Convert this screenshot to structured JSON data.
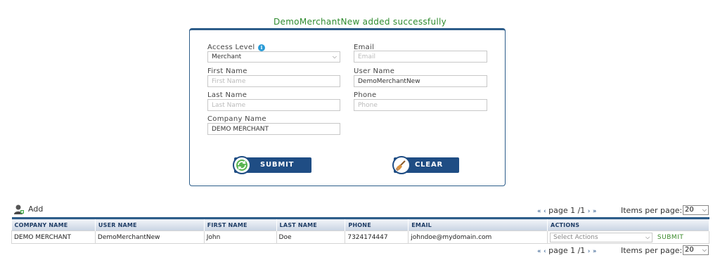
{
  "message": "DemoMerchantNew added successfully",
  "form": {
    "access_level_label": "Access Level",
    "access_level_value": "Merchant",
    "first_name_label": "First Name",
    "first_name_placeholder": "First Name",
    "last_name_label": "Last Name",
    "last_name_placeholder": "Last Name",
    "company_name_label": "Company Name",
    "company_name_value": "DEMO MERCHANT",
    "email_label": "Email",
    "email_placeholder": "Email",
    "user_name_label": "User Name",
    "user_name_value": "DemoMerchantNew",
    "phone_label": "Phone",
    "phone_placeholder": "Phone",
    "submit_label": "SUBMIT",
    "clear_label": "CLEAR",
    "info_glyph": "i"
  },
  "list": {
    "add_label": "Add",
    "pager_first": "«",
    "pager_prev": "‹",
    "pager_text": "page 1 /1",
    "pager_next": "›",
    "pager_last": "»",
    "items_per_page_label": "Items per page:",
    "items_per_page_value": "20",
    "columns": [
      "COMPANY NAME",
      "USER NAME",
      "FIRST NAME",
      "LAST NAME",
      "PHONE",
      "EMAIL",
      "ACTIONS"
    ],
    "rows": [
      {
        "company": "DEMO MERCHANT",
        "user_name": "DemoMerchantNew",
        "first_name": "John",
        "last_name": "Doe",
        "phone": "7324174447",
        "email": "johndoe@mydomain.com",
        "actions_placeholder": "Select Actions",
        "submit": "SUBMIT"
      }
    ]
  },
  "colors": {
    "brand_blue": "#1f4d84",
    "success_green": "#2e8b2e"
  }
}
